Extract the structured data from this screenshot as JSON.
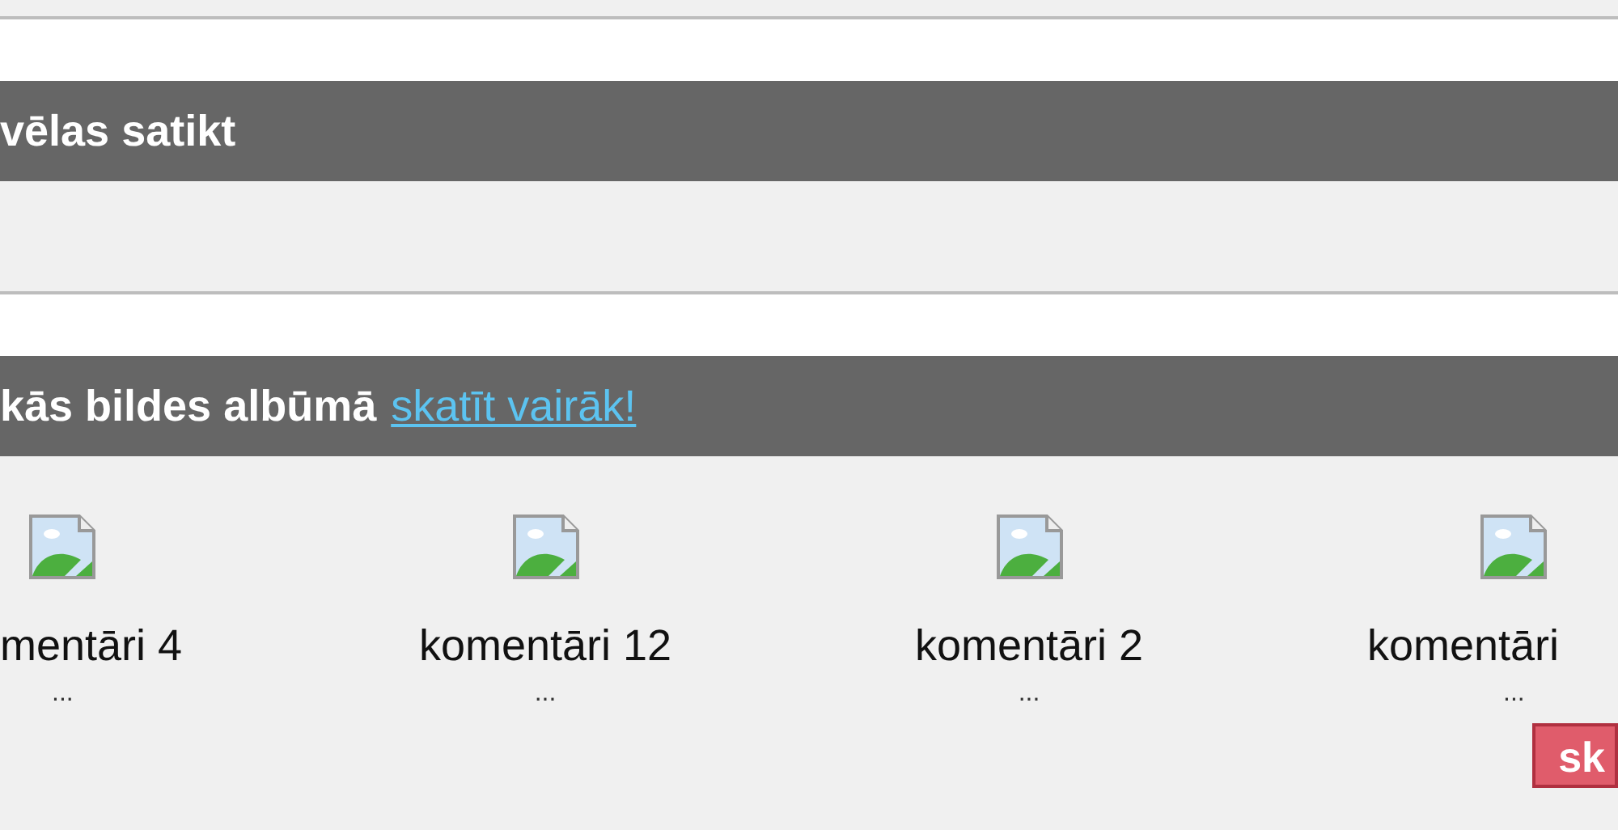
{
  "sections": [
    {
      "title": "vēlas satikt"
    },
    {
      "title": "kās bildes albūmā",
      "link": "skatīt vairāk!"
    }
  ],
  "album": [
    {
      "caption": "mentāri 4",
      "more": "..."
    },
    {
      "caption": "komentāri 12",
      "more": "..."
    },
    {
      "caption": "komentāri 2",
      "more": "..."
    },
    {
      "caption": "komentāri",
      "more": "..."
    }
  ],
  "button": "sk"
}
